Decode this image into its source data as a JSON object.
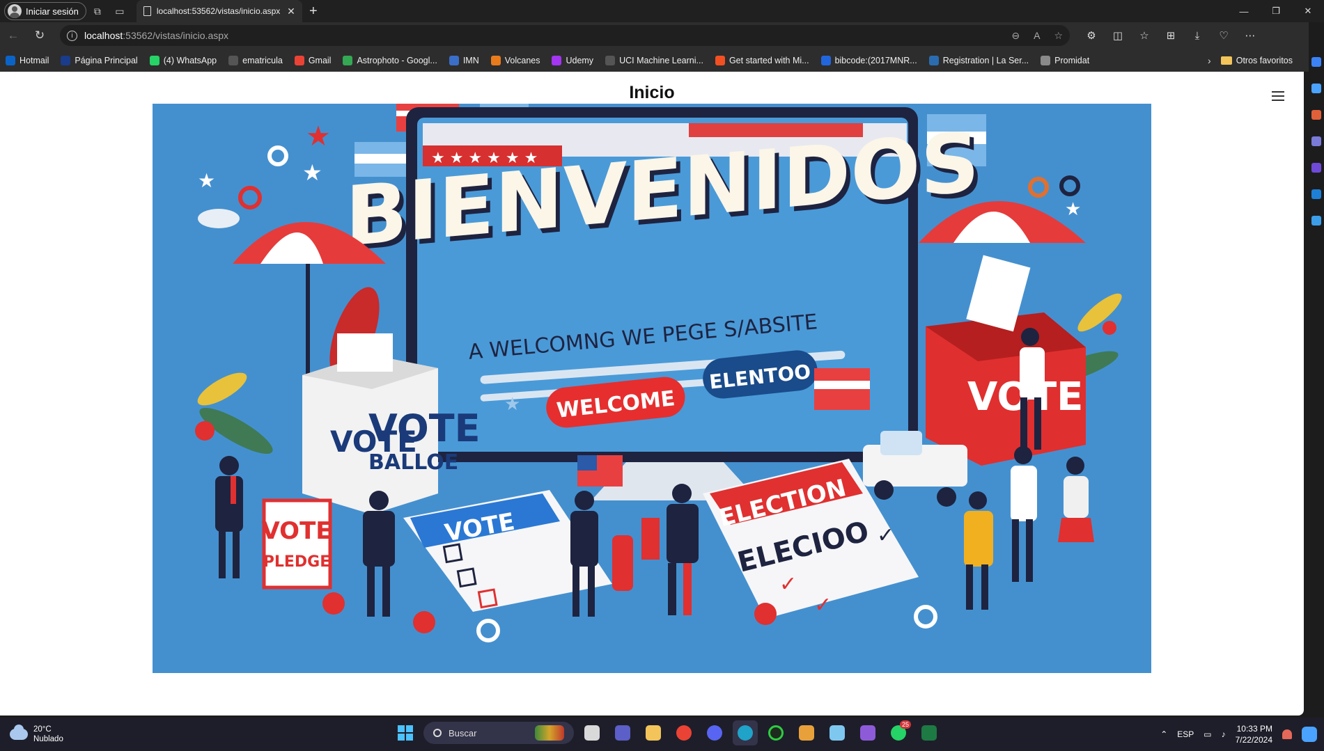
{
  "browser": {
    "profile_label": "Iniciar sesión",
    "tab_title": "localhost:53562/vistas/inicio.aspx",
    "url_host": "localhost",
    "url_path": ":53562/vistas/inicio.aspx"
  },
  "bookmarks": [
    {
      "label": "Hotmail",
      "color": "#0a64c8"
    },
    {
      "label": "Página Principal",
      "color": "#1a3c8a"
    },
    {
      "label": "(4) WhatsApp",
      "color": "#25d366"
    },
    {
      "label": "ematricula",
      "color": "#555555"
    },
    {
      "label": "Gmail",
      "color": "#ea4335"
    },
    {
      "label": "Astrophoto - Googl...",
      "color": "#34a853"
    },
    {
      "label": "IMN",
      "color": "#3a6ec8"
    },
    {
      "label": "Volcanes",
      "color": "#e87b1c"
    },
    {
      "label": "Udemy",
      "color": "#a435f0"
    },
    {
      "label": "UCI Machine Learni...",
      "color": "#555555"
    },
    {
      "label": "Get started with Mi...",
      "color": "#f25022"
    },
    {
      "label": "bibcode:(2017MNR...",
      "color": "#2266dd"
    },
    {
      "label": "Registration | La Ser...",
      "color": "#2b6cb0"
    },
    {
      "label": "Promidat",
      "color": "#8a8a8a"
    }
  ],
  "bookmarks_folder": "Otros favoritos",
  "page": {
    "title": "Inicio",
    "hero": {
      "headline": "BIENVENIDOS",
      "subline": "A WELCOMNG  WE PEGE S/ABSITE",
      "welcome_btn": "WELCOME",
      "election_btn": "ELENTOO",
      "ballot_box_left": "VOTE",
      "ballot_box_left2": "VOTE",
      "ballot_box_left3": "BALLOE",
      "ballot_box_right": "VOTE",
      "sign_left": "VOTE",
      "sign_left2": "PLEDGE",
      "paper_vote": "VOTE",
      "paper_election": "ELECTION",
      "paper_election2": "ELECIOO"
    }
  },
  "taskbar": {
    "weather_temp": "20°C",
    "weather_desc": "Nublado",
    "search_placeholder": "Buscar",
    "lang": "ESP",
    "time": "10:33 PM",
    "date": "7/22/2024",
    "whatsapp_badge": "25"
  }
}
